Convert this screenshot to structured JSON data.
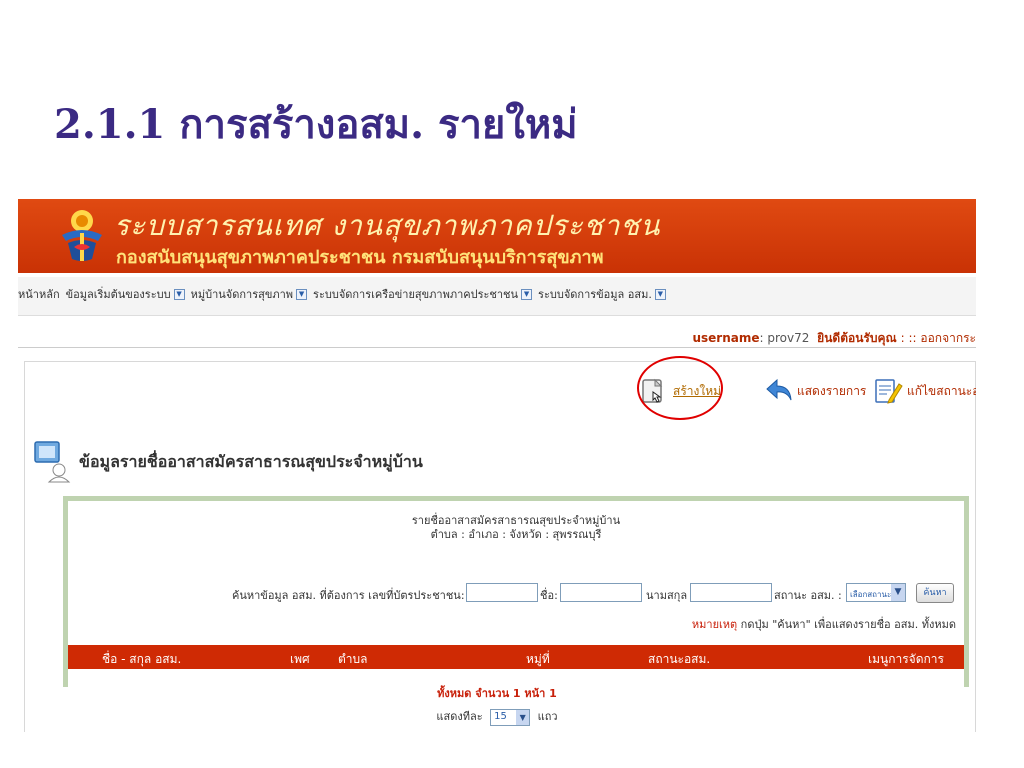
{
  "slide_title": "2.1.1 การสร้างอสม. รายใหม่",
  "banner": {
    "title": "ระบบสารสนเทศ งานสุขภาพภาคประชาชน",
    "subtitle": "กองสนับสนุนสุขภาพภาคประชาชน กรมสนับสนุนบริการสุขภาพ"
  },
  "menu": {
    "items": [
      {
        "label": "หน้าหลัก",
        "has_dropdown": false
      },
      {
        "label": "ข้อมูลเริ่มต้นของระบบ",
        "has_dropdown": true
      },
      {
        "label": "หมู่บ้านจัดการสุขภาพ",
        "has_dropdown": true
      },
      {
        "label": "ระบบจัดการเครือข่ายสุขภาพภาคประชาชน",
        "has_dropdown": true
      },
      {
        "label": "ระบบจัดการข้อมูล อสม.",
        "has_dropdown": true
      }
    ]
  },
  "user": {
    "key_label": "username",
    "value": ": prov72",
    "welcome": "ยินดีต้อนรับคุณ",
    "logout": ": :: ออกจากระ"
  },
  "actions": {
    "new": "สร้างใหม่",
    "list": "แสดงรายการ",
    "edit": "แก้ไขสถานะอสม"
  },
  "heading": "ข้อมูลรายชื่ออาสาสมัครสาธารณสุขประจำหมู่บ้าน",
  "list": {
    "title": "รายชื่ออาสาสมัครสาธารณสุขประจำหมู่บ้าน",
    "location": "ตำบล : อำเภอ : จังหวัด : สุพรรณบุรี"
  },
  "search": {
    "id_label": "ค้นหาข้อมูล อสม. ที่ต้องการ เลขที่บัตรประชาชน:",
    "name_label": "ชื่อ:",
    "surname_label": "นามสกุล",
    "status_label": "สถานะ อสม. :",
    "status_value": "เลือกสถานะ",
    "button": "ค้นหา"
  },
  "note": {
    "key": "หมายเหตุ",
    "text": " กดปุ่ม \"ค้นหา\" เพื่อแสดงรายชื่อ อสม. ทั้งหมด"
  },
  "table": {
    "columns": [
      "ชื่อ - สกุล อสม.",
      "เพศ",
      "ตำบล",
      "หมู่ที่",
      "สถานะอสม.",
      "เมนูการจัดการ"
    ]
  },
  "summary": "ทั้งหมด จำนวน 1 หน้า 1",
  "paging": {
    "prefix": "แสดงทีละ",
    "value": "15",
    "suffix": "แถว"
  },
  "colors": {
    "banner": "#c93205",
    "table_header": "#cf2a04",
    "slide_title": "#3b2a83",
    "highlight_circle": "#e00000"
  }
}
